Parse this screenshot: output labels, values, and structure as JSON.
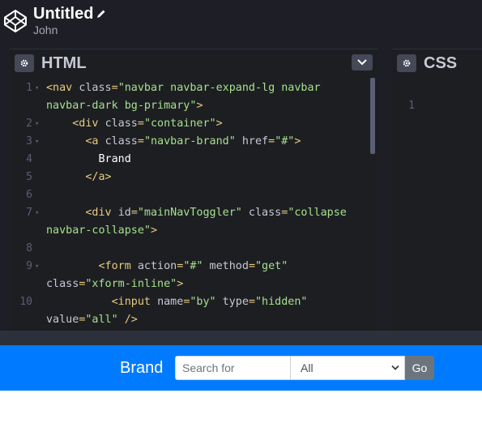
{
  "header": {
    "title": "Untitled",
    "author": "John"
  },
  "html_panel": {
    "label": "HTML",
    "lines": [
      {
        "num": "1",
        "fold": true,
        "parts": [
          [
            "tag",
            "<nav "
          ],
          [
            "attr",
            "class"
          ],
          [
            "tag",
            "="
          ],
          [
            "str",
            "\"navbar navbar-expand-lg navbar"
          ]
        ]
      },
      {
        "num": "",
        "fold": false,
        "parts": [
          [
            "str",
            "navbar-dark bg-primary\""
          ],
          [
            "tag",
            ">"
          ]
        ]
      },
      {
        "num": "2",
        "fold": true,
        "parts": [
          [
            "txt",
            "    "
          ],
          [
            "tag",
            "<div "
          ],
          [
            "attr",
            "class"
          ],
          [
            "tag",
            "="
          ],
          [
            "str",
            "\"container\""
          ],
          [
            "tag",
            ">"
          ]
        ]
      },
      {
        "num": "3",
        "fold": true,
        "parts": [
          [
            "txt",
            "      "
          ],
          [
            "tag",
            "<a "
          ],
          [
            "attr",
            "class"
          ],
          [
            "tag",
            "="
          ],
          [
            "str",
            "\"navbar-brand\""
          ],
          [
            "attr",
            " href"
          ],
          [
            "tag",
            "="
          ],
          [
            "str",
            "\"#\""
          ],
          [
            "tag",
            ">"
          ]
        ]
      },
      {
        "num": "4",
        "fold": false,
        "parts": [
          [
            "txt",
            "        Brand"
          ]
        ]
      },
      {
        "num": "5",
        "fold": false,
        "parts": [
          [
            "txt",
            "      "
          ],
          [
            "tag",
            "</a>"
          ]
        ]
      },
      {
        "num": "6",
        "fold": false,
        "parts": []
      },
      {
        "num": "7",
        "fold": true,
        "parts": [
          [
            "txt",
            "      "
          ],
          [
            "tag",
            "<div "
          ],
          [
            "attr",
            "id"
          ],
          [
            "tag",
            "="
          ],
          [
            "str",
            "\"mainNavToggler\""
          ],
          [
            "attr",
            " class"
          ],
          [
            "tag",
            "="
          ],
          [
            "str",
            "\"collapse"
          ]
        ]
      },
      {
        "num": "",
        "fold": false,
        "parts": [
          [
            "str",
            "navbar-collapse\""
          ],
          [
            "tag",
            ">"
          ]
        ]
      },
      {
        "num": "8",
        "fold": false,
        "parts": []
      },
      {
        "num": "9",
        "fold": true,
        "parts": [
          [
            "txt",
            "        "
          ],
          [
            "tag",
            "<form "
          ],
          [
            "attr",
            "action"
          ],
          [
            "tag",
            "="
          ],
          [
            "str",
            "\"#\""
          ],
          [
            "attr",
            " method"
          ],
          [
            "tag",
            "="
          ],
          [
            "str",
            "\"get\""
          ]
        ]
      },
      {
        "num": "",
        "fold": false,
        "parts": [
          [
            "attr",
            "class"
          ],
          [
            "tag",
            "="
          ],
          [
            "str",
            "\"xform-inline\""
          ],
          [
            "tag",
            ">"
          ]
        ]
      },
      {
        "num": "10",
        "fold": false,
        "parts": [
          [
            "txt",
            "          "
          ],
          [
            "tag",
            "<input "
          ],
          [
            "attr",
            "name"
          ],
          [
            "tag",
            "="
          ],
          [
            "str",
            "\"by\""
          ],
          [
            "attr",
            " type"
          ],
          [
            "tag",
            "="
          ],
          [
            "str",
            "\"hidden\""
          ]
        ]
      },
      {
        "num": "",
        "fold": false,
        "parts": [
          [
            "attr",
            "value"
          ],
          [
            "tag",
            "="
          ],
          [
            "str",
            "\"all\""
          ],
          [
            "tag",
            " />"
          ]
        ]
      }
    ]
  },
  "css_panel": {
    "label": "CSS",
    "first_line": "1"
  },
  "preview": {
    "brand": "Brand",
    "search_placeholder": "Search for",
    "select_value": "All",
    "go_label": "Go"
  },
  "colors": {
    "navbar": "#007bff",
    "editor_bg": "#1d1e22",
    "tag": "#e6cc7f",
    "string": "#a5e08e"
  }
}
